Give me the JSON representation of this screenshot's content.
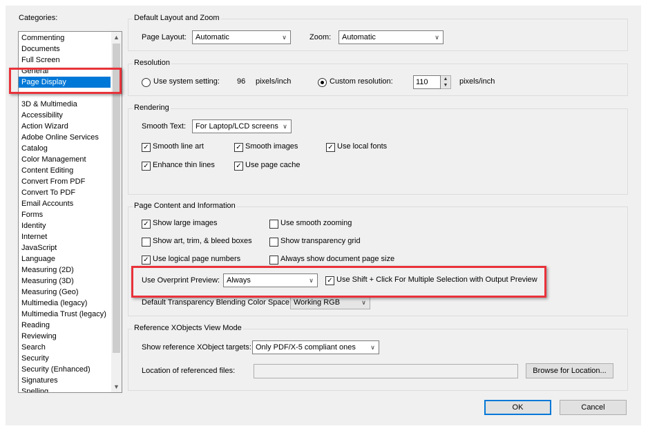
{
  "categories": {
    "label": "Categories:",
    "items": [
      "Commenting",
      "Documents",
      "Full Screen",
      "General",
      "Page Display",
      "",
      "3D & Multimedia",
      "Accessibility",
      "Action Wizard",
      "Adobe Online Services",
      "Catalog",
      "Color Management",
      "Content Editing",
      "Convert From PDF",
      "Convert To PDF",
      "Email Accounts",
      "Forms",
      "Identity",
      "Internet",
      "JavaScript",
      "Language",
      "Measuring (2D)",
      "Measuring (3D)",
      "Measuring (Geo)",
      "Multimedia (legacy)",
      "Multimedia Trust (legacy)",
      "Reading",
      "Reviewing",
      "Search",
      "Security",
      "Security (Enhanced)",
      "Signatures",
      "Spelling"
    ],
    "selected": "Page Display"
  },
  "layout_zoom": {
    "title": "Default Layout and Zoom",
    "page_layout_label": "Page Layout:",
    "page_layout_value": "Automatic",
    "zoom_label": "Zoom:",
    "zoom_value": "Automatic"
  },
  "resolution": {
    "title": "Resolution",
    "system_label": "Use system setting:",
    "system_value": "96",
    "system_unit": "pixels/inch",
    "custom_label": "Custom resolution:",
    "custom_value": "110",
    "custom_unit": "pixels/inch",
    "selected": "custom"
  },
  "rendering": {
    "title": "Rendering",
    "smooth_text_label": "Smooth Text:",
    "smooth_text_value": "For Laptop/LCD screens",
    "options": [
      {
        "label": "Smooth line art",
        "checked": true
      },
      {
        "label": "Smooth images",
        "checked": true
      },
      {
        "label": "Use local fonts",
        "checked": true
      },
      {
        "label": "Enhance thin lines",
        "checked": true
      },
      {
        "label": "Use page cache",
        "checked": true
      }
    ]
  },
  "page_content": {
    "title": "Page Content and Information",
    "options": [
      {
        "label": "Show large images",
        "checked": true
      },
      {
        "label": "Use smooth zooming",
        "checked": false
      },
      {
        "label": "Show art, trim, & bleed boxes",
        "checked": false
      },
      {
        "label": "Show transparency grid",
        "checked": false
      },
      {
        "label": "Use logical page numbers",
        "checked": true
      },
      {
        "label": "Always show document page size",
        "checked": false
      }
    ],
    "overprint_label": "Use Overprint Preview:",
    "overprint_value": "Always",
    "shift_click_label": "Use Shift + Click For Multiple Selection with Output Preview",
    "shift_click_checked": true,
    "blending_label": "Default Transparency Blending Color Space:",
    "blending_value": "Working RGB"
  },
  "xobjects": {
    "title": "Reference XObjects View Mode",
    "targets_label": "Show reference XObject targets:",
    "targets_value": "Only PDF/X-5 compliant ones",
    "location_label": "Location of referenced files:",
    "location_value": "",
    "browse_label": "Browse for Location..."
  },
  "buttons": {
    "ok": "OK",
    "cancel": "Cancel"
  },
  "icons": {
    "dropdown": "chevron-down-icon",
    "check": "checkmark-icon",
    "scroll_up": "arrow-up-icon",
    "scroll_down": "arrow-down-icon"
  },
  "colors": {
    "selection": "#0078d7",
    "highlight": "#e8323a",
    "ok_border": "#0078d7"
  }
}
